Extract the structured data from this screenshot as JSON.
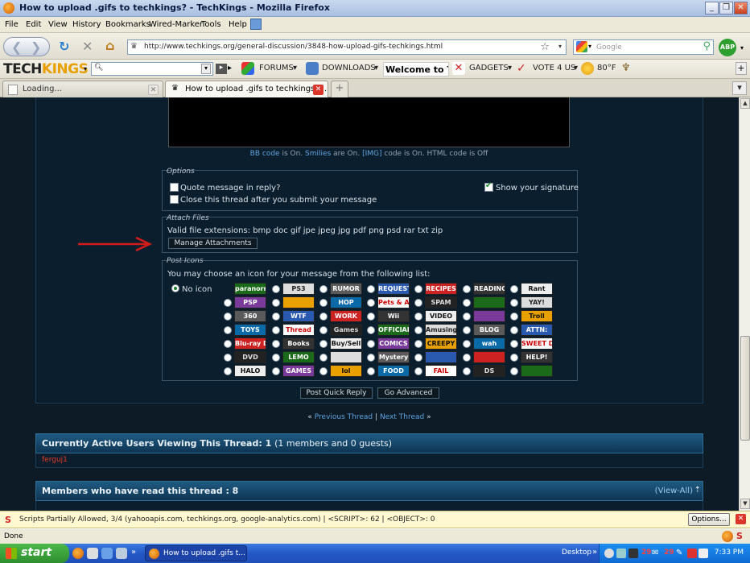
{
  "window": {
    "title": "How to upload .gifs to techkings? - TechKings - Mozilla Firefox"
  },
  "menu": [
    "File",
    "Edit",
    "View",
    "History",
    "Bookmarks",
    "Wired-Marker",
    "Tools",
    "Help"
  ],
  "nav": {
    "url": "http://www.techkings.org/general-discussion/3848-how-upload-gifs-techkings.html",
    "search_placeholder": "Google",
    "abp_label": "ABP"
  },
  "tk_toolbar": {
    "logo_tech": "TECH",
    "logo_kings": "KINGS",
    "search_prefix": "Q",
    "forums": "FORUMS",
    "downloads": "DOWNLOADS",
    "welcome": "Welcome to T",
    "gadgets": "GADGETS",
    "vote": "VOTE 4 US",
    "weather": "80°F"
  },
  "tabs": [
    {
      "label": "Loading..."
    },
    {
      "label": "How to upload .gifs to techkings?..."
    }
  ],
  "editor": {
    "bb_code": "BB code",
    "is_on_1": "is On.",
    "smilies": "Smilies",
    "are_on": "are On.",
    "img": "[IMG]",
    "code_on_html_off": "code is On. HTML code is Off"
  },
  "options": {
    "legend": "Options",
    "quote": "Quote message in reply?",
    "close_thread": "Close this thread after you submit your message",
    "show_signature": "Show your signature"
  },
  "attach": {
    "legend": "Attach Files",
    "valid_ext": "Valid file extensions: bmp doc gif jpe jpeg jpg pdf png psd rar txt zip",
    "manage_button": "Manage Attachments"
  },
  "post_icons": {
    "legend": "Post Icons",
    "intro": "You may choose an icon for your message from the following list:",
    "no_icon": "No icon",
    "tiles": [
      [
        "paranormal",
        "PS3",
        "RUMOR",
        "REQUEST",
        "RECIPES",
        "READING",
        "Rant"
      ],
      [
        "PSP",
        "",
        "HOP",
        "Pets & Animals",
        "SPAM",
        "",
        "YAY!"
      ],
      [
        "360",
        "WTF",
        "WORK",
        "Wii",
        "VIDEO",
        "",
        "Troll"
      ],
      [
        "TOYS",
        "Thread",
        "Games",
        "OFFICIAL",
        "Amusing",
        "BLOG",
        "ATTN:"
      ],
      [
        "Blu-ray Disc",
        "Books",
        "Buy/Sell",
        "COMICS",
        "CREEPY",
        "wah",
        "SWEET DEALS"
      ],
      [
        "DVD",
        "LEMO",
        "",
        "Mystery",
        "",
        "",
        "HELP!"
      ],
      [
        "HALO",
        "GAMES",
        "lol",
        "FOOD",
        "FAIL",
        "DS",
        ""
      ]
    ]
  },
  "actions": {
    "post_quick_reply": "Post Quick Reply",
    "go_advanced": "Go Advanced"
  },
  "thread_nav": {
    "prev": "Previous Thread",
    "sep": "|",
    "next": "Next Thread"
  },
  "active_users": {
    "heading_bold": "Currently Active Users Viewing This Thread: 1",
    "heading_rest": "(1 members and 0 guests)",
    "user": "ferguj1"
  },
  "members_read": {
    "heading": "Members who have read this thread : 8",
    "view_all": "View-All"
  },
  "notification": {
    "message": "Scripts Partially Allowed, 3/4 (yahooapis.com, techkings.org, google-analytics.com) | <SCRIPT>: 62 | <OBJECT>: 0",
    "options_button": "Options..."
  },
  "status": {
    "text": "Done"
  },
  "taskbar": {
    "start": "start",
    "task_item": "How to upload .gifs t...",
    "desktop": "Desktop",
    "tray_num1": "29",
    "tray_num2": "29",
    "clock": "7:33 PM"
  }
}
